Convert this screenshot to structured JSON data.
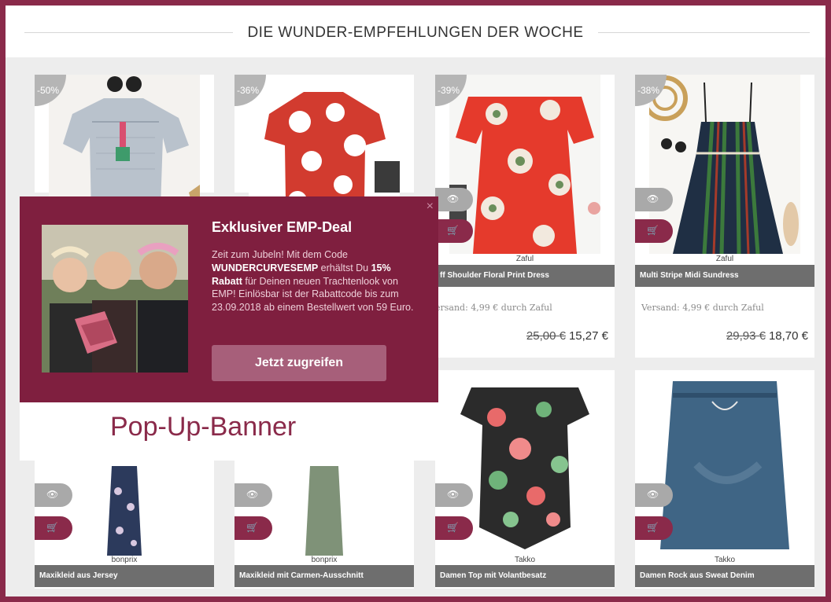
{
  "section_title": "DIE WUNDER-EMPFEHLUNGEN DER WOCHE",
  "colors": {
    "accent": "#8a2a4a",
    "popup_bg": "#7f1f3f",
    "namebar": "#6e6e6e"
  },
  "products_row1": [
    {
      "discount": "-50%",
      "brand": "",
      "name": "",
      "shipping": "",
      "old_price": "",
      "price": ""
    },
    {
      "discount": "-36%",
      "brand": "",
      "name": "",
      "shipping": "",
      "old_price": "",
      "price": ""
    },
    {
      "discount": "-39%",
      "brand": "Zaful",
      "name": "ff Shoulder Floral Print Dress",
      "shipping": "ersand: 4,99 € durch Zaful",
      "old_price": "25,00 €",
      "price": "15,27 €"
    },
    {
      "discount": "-38%",
      "brand": "Zaful",
      "name": "Multi Stripe Midi Sundress",
      "shipping": "Versand: 4,99 € durch Zaful",
      "old_price": "29,93 €",
      "price": "18,70 €"
    }
  ],
  "products_row2": [
    {
      "brand": "bonprix",
      "name": "Maxikleid aus Jersey"
    },
    {
      "brand": "bonprix",
      "name": "Maxikleid mit Carmen-Ausschnitt"
    },
    {
      "brand": "Takko",
      "name": "Damen Top mit Volantbesatz"
    },
    {
      "brand": "Takko",
      "name": "Damen Rock aus Sweat Denim"
    }
  ],
  "popup": {
    "close": "×",
    "title": "Exklusiver EMP-Deal",
    "text_1": "Zeit zum Jubeln! Mit dem Code ",
    "code": "WUNDERCURVESEMP",
    "text_2": " erhältst Du ",
    "discount": "15% Rabatt",
    "text_3": " für Deinen neuen Trachtenlook von EMP! Einlösbar ist der Rabattcode bis zum 23.09.2018 ab einem Bestellwert von 59 Euro.",
    "button": "Jetzt zugreifen"
  },
  "annotation": "Pop-Up-Banner",
  "icons": {
    "eye": "eye-icon",
    "cart": "cart-icon",
    "close": "close-icon"
  }
}
